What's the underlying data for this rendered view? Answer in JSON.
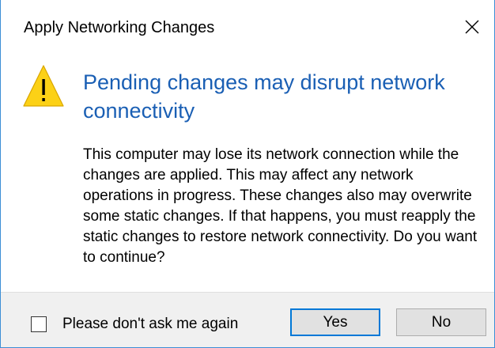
{
  "window": {
    "title": "Apply Networking Changes",
    "close_icon": "close-icon"
  },
  "content": {
    "icon": "warning-icon",
    "heading": "Pending changes may disrupt network connectivity",
    "body": "This computer may lose its network connection while the changes are applied. This may affect any network operations in progress. These changes also may overwrite some static changes. If that happens, you must reapply the static changes to restore network connectivity. Do you want to continue?"
  },
  "footer": {
    "checkbox_label": "Please don't ask me again",
    "checkbox_checked": false,
    "yes_label": "Yes",
    "no_label": "No",
    "default_button": "Yes"
  },
  "colors": {
    "heading": "#1a5fb4",
    "window_border": "#3c8fd6",
    "default_button_border": "#0078d7",
    "warning_fill": "#fcd116",
    "footer_bg": "#f0f0f0"
  }
}
